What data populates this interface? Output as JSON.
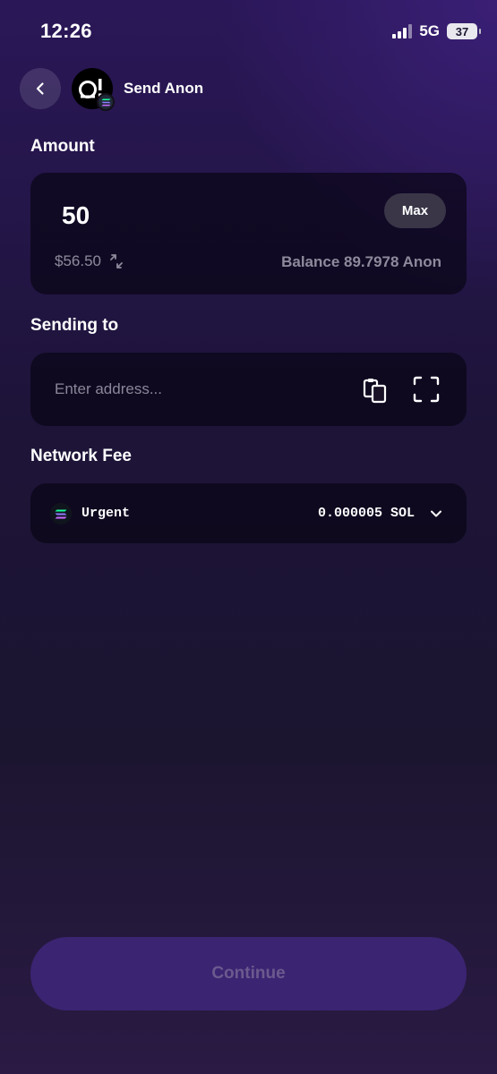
{
  "status_bar": {
    "time": "12:26",
    "network": "5G",
    "battery": "37"
  },
  "header": {
    "title": "Send Anon"
  },
  "amount_section": {
    "label": "Amount",
    "value": "50",
    "max_label": "Max",
    "fiat_value": "$56.50",
    "balance": "Balance 89.7978 Anon"
  },
  "recipient_section": {
    "label": "Sending to",
    "placeholder": "Enter address..."
  },
  "fee_section": {
    "label": "Network Fee",
    "speed": "Urgent",
    "amount": "0.000005 SOL"
  },
  "continue_label": "Continue"
}
